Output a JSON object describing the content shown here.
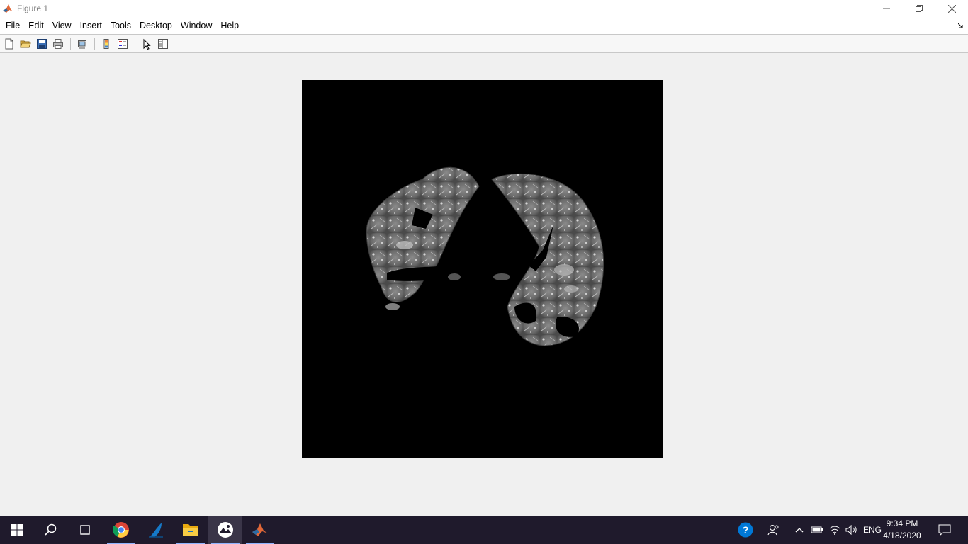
{
  "window": {
    "title": "Figure 1",
    "icon": "matlab-icon",
    "controls": [
      "minimize-icon",
      "restore-icon",
      "close-icon"
    ]
  },
  "menu": {
    "items": [
      "File",
      "Edit",
      "View",
      "Insert",
      "Tools",
      "Desktop",
      "Window",
      "Help"
    ]
  },
  "toolbar": {
    "buttons": [
      "new-figure-icon",
      "open-file-icon",
      "save-icon",
      "print-icon",
      "link-plot-icon",
      "insert-colorbar-icon",
      "insert-legend-icon",
      "edit-plot-icon",
      "property-inspector-icon"
    ]
  },
  "figure": {
    "content": "segmented lung CT image",
    "background": "#000000"
  },
  "taskbar": {
    "apps": [
      "start-icon",
      "search-icon",
      "task-view-icon",
      "chrome-icon",
      "wireshark-icon",
      "file-explorer-icon",
      "photos-icon",
      "matlab-icon"
    ],
    "tray": {
      "language": "ENG",
      "time": "9:34 PM",
      "date": "4/18/2020"
    }
  },
  "colors": {
    "taskbar": "#1f1a2c",
    "help_blue": "#0078d7"
  }
}
